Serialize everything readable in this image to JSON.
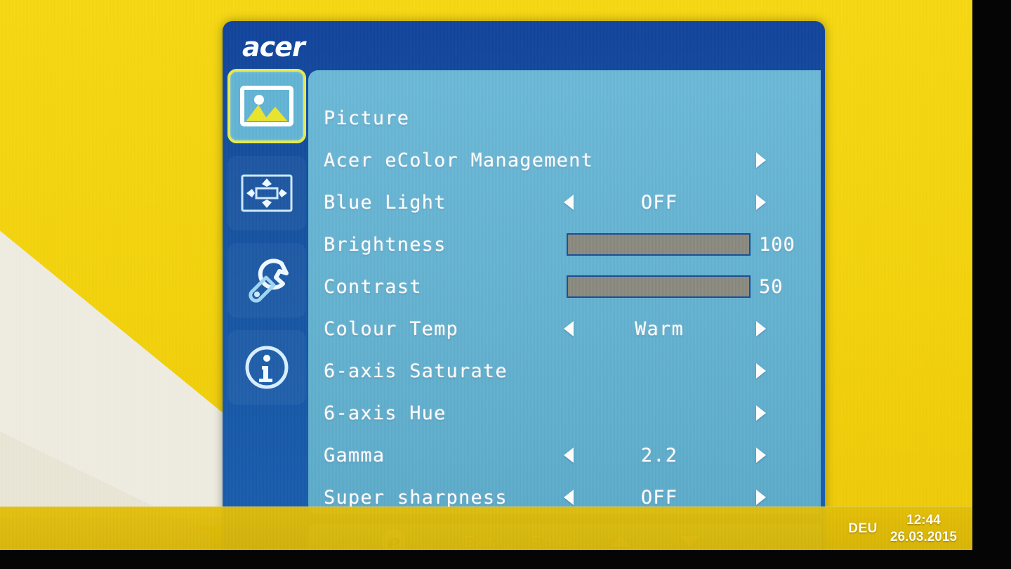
{
  "desktop": {
    "wallpaper_color": "#f2d513",
    "accent_cream": "#eeece0",
    "taskbar": {
      "language_indicator": "DEU",
      "clock_time": "12:44",
      "clock_date": "26.03.2015"
    }
  },
  "osd": {
    "brand": "acer",
    "panel_bg": "#63b4d4",
    "frame_bg": "#17529e",
    "selected_outline": "#e7ea4a",
    "sidebar": [
      {
        "name": "picture-icon",
        "label": "Picture",
        "selected": true
      },
      {
        "name": "osd-position-icon",
        "label": "OSD",
        "selected": false
      },
      {
        "name": "setting-icon",
        "label": "Setting",
        "selected": false
      },
      {
        "name": "information-icon",
        "label": "Information",
        "selected": false
      }
    ],
    "title": "Picture",
    "menu": [
      {
        "label": "Acer eColor Management",
        "kind": "submenu",
        "value": ""
      },
      {
        "label": "Blue Light",
        "kind": "option",
        "value": "OFF"
      },
      {
        "label": "Brightness",
        "kind": "slider",
        "value": "100",
        "percent": 100
      },
      {
        "label": "Contrast",
        "kind": "slider",
        "value": "50",
        "percent": 50
      },
      {
        "label": "Colour Temp",
        "kind": "option",
        "value": "Warm"
      },
      {
        "label": "6-axis Saturate",
        "kind": "submenu",
        "value": ""
      },
      {
        "label": "6-axis Hue",
        "kind": "submenu",
        "value": ""
      },
      {
        "label": "Gamma",
        "kind": "option",
        "value": "2.2"
      },
      {
        "label": "Super sharpness",
        "kind": "option",
        "value": "OFF"
      }
    ],
    "hintbar": {
      "ecolor_icon": "ecolor-e-icon",
      "exit": "Exit",
      "enter": "Enter",
      "up": "up-arrow-icon",
      "down": "down-arrow-icon"
    }
  }
}
